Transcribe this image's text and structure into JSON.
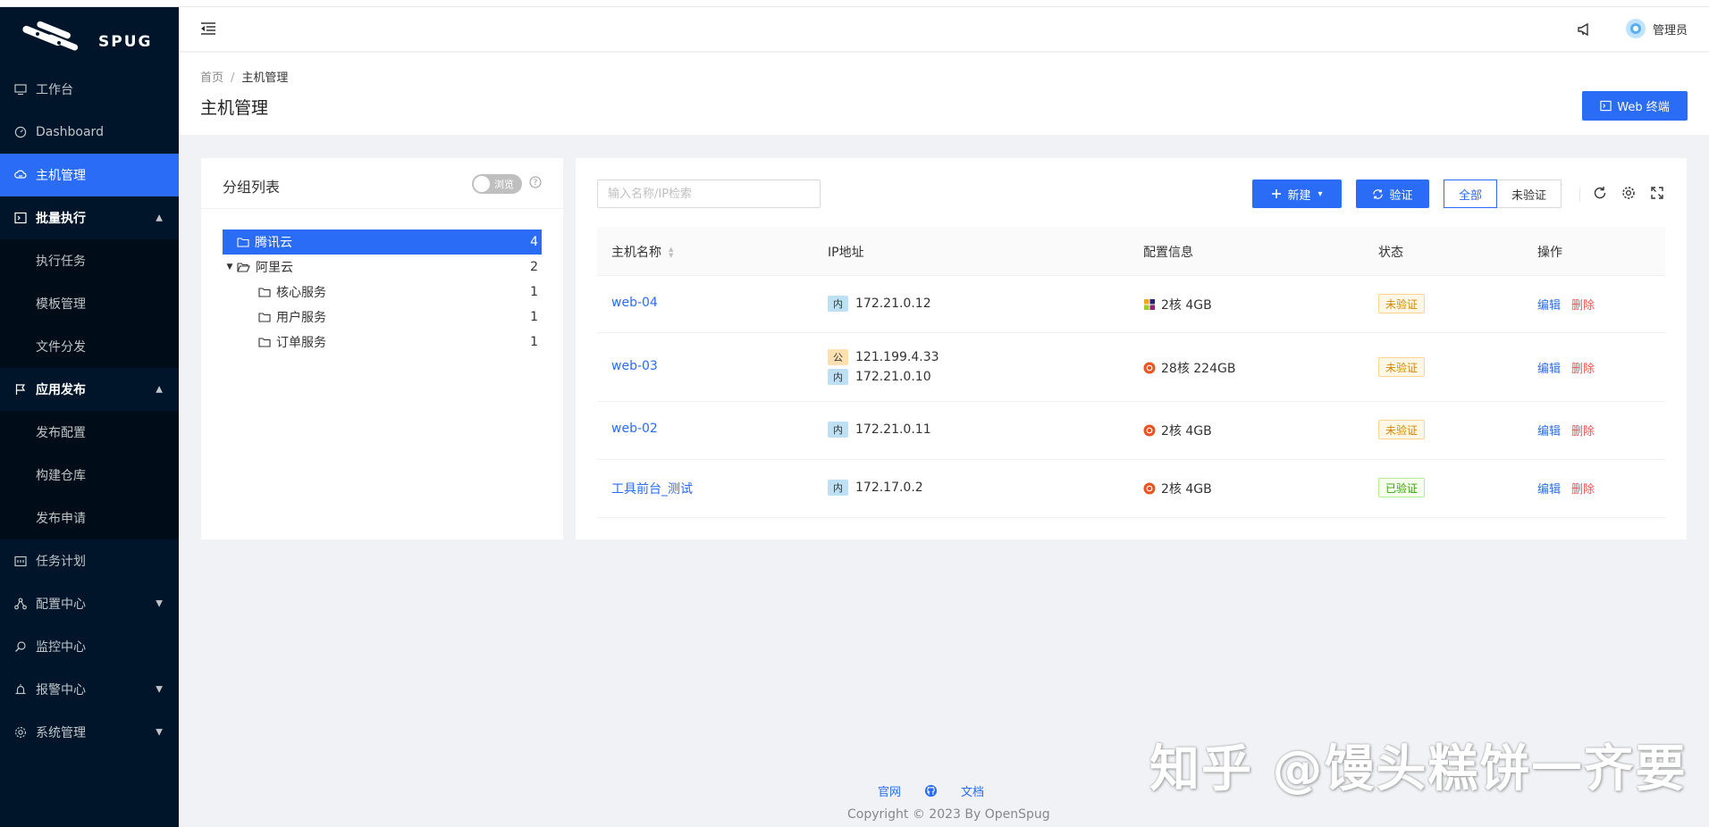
{
  "sidebar": {
    "logo_text": "SPUG",
    "items": [
      {
        "label": "工作台"
      },
      {
        "label": "Dashboard"
      },
      {
        "label": "主机管理"
      },
      {
        "label": "批量执行",
        "children": [
          "执行任务",
          "模板管理",
          "文件分发"
        ]
      },
      {
        "label": "应用发布",
        "children": [
          "发布配置",
          "构建仓库",
          "发布申请"
        ]
      },
      {
        "label": "任务计划"
      },
      {
        "label": "配置中心"
      },
      {
        "label": "监控中心"
      },
      {
        "label": "报警中心"
      },
      {
        "label": "系统管理"
      }
    ],
    "active_item": "主机管理",
    "accent": "#2b6cf6",
    "bg": "#001529"
  },
  "header": {
    "user_name": "管理员",
    "icons": [
      "menu-fold-icon",
      "notification-icon",
      "avatar"
    ]
  },
  "page": {
    "breadcrumb": [
      "首页",
      "主机管理"
    ],
    "title": "主机管理",
    "web_terminal_label": "Web 终端"
  },
  "groups": {
    "title": "分组列表",
    "switch_label": "浏览",
    "tree": [
      {
        "name": "腾讯云",
        "count": "4",
        "selected": true,
        "level": 0
      },
      {
        "name": "阿里云",
        "count": "2",
        "expanded": true,
        "level": 0
      },
      {
        "name": "核心服务",
        "count": "1",
        "level": 1
      },
      {
        "name": "用户服务",
        "count": "1",
        "level": 1
      },
      {
        "name": "订单服务",
        "count": "1",
        "level": 1
      }
    ]
  },
  "hosts": {
    "search_placeholder": "输入名称/IP检索",
    "new_label": "新建",
    "verify_label": "验证",
    "filter": {
      "all": "全部",
      "unverified": "未验证"
    },
    "columns": [
      "主机名称",
      "IP地址",
      "配置信息",
      "状态",
      "操作"
    ],
    "rows": [
      {
        "name": "web-04",
        "ips": [
          {
            "tag": "内",
            "ip": "172.21.0.12"
          }
        ],
        "spec": "2核 4GB",
        "os": "centos",
        "status": "未验证",
        "verified": false
      },
      {
        "name": "web-03",
        "ips": [
          {
            "tag": "公",
            "ip": "121.199.4.33"
          },
          {
            "tag": "内",
            "ip": "172.21.0.10"
          }
        ],
        "spec": "28核 224GB",
        "os": "ubuntu",
        "status": "未验证",
        "verified": false
      },
      {
        "name": "web-02",
        "ips": [
          {
            "tag": "内",
            "ip": "172.21.0.11"
          }
        ],
        "spec": "2核 4GB",
        "os": "ubuntu",
        "status": "未验证",
        "verified": false
      },
      {
        "name": "工具前台_测试",
        "ips": [
          {
            "tag": "内",
            "ip": "172.17.0.2"
          }
        ],
        "spec": "2核 4GB",
        "os": "ubuntu",
        "status": "已验证",
        "verified": true
      }
    ],
    "actions": {
      "edit": "编辑",
      "delete": "删除"
    }
  },
  "footer": {
    "links": [
      "官网",
      "文档"
    ],
    "copyright": "Copyright © 2023 By OpenSpug"
  },
  "watermark": "知乎 @馒头糕饼一齐要"
}
